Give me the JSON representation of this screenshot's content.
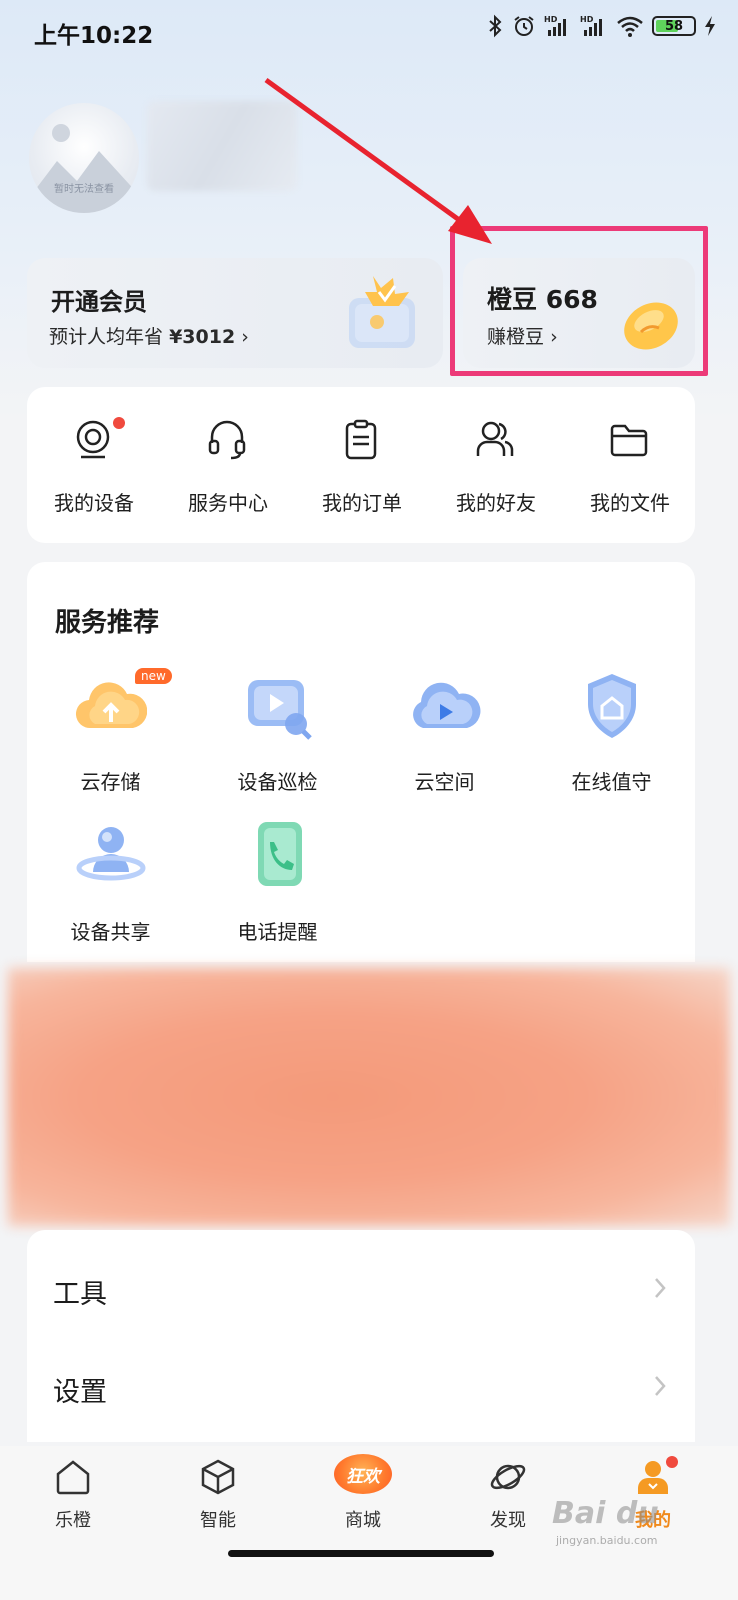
{
  "status_bar": {
    "time": "上午10:22",
    "battery": "58"
  },
  "profile": {
    "avatar_caption": "暂时无法查看"
  },
  "vip_card": {
    "title": "开通会员",
    "subtitle_prefix": "预计人均年省",
    "amount": "¥3012",
    "chevron": "›"
  },
  "beans_card": {
    "title": "橙豆 668",
    "subtitle": "赚橙豆",
    "chevron": "›"
  },
  "quick_menu": {
    "items": [
      {
        "label": "我的设备",
        "icon": "camera-icon",
        "has_dot": true
      },
      {
        "label": "服务中心",
        "icon": "headset-icon"
      },
      {
        "label": "我的订单",
        "icon": "clipboard-icon"
      },
      {
        "label": "我的好友",
        "icon": "friends-icon"
      },
      {
        "label": "我的文件",
        "icon": "folder-icon"
      }
    ]
  },
  "services": {
    "title": "服务推荐",
    "new_badge": "new",
    "items": [
      {
        "label": "云存储",
        "icon": "cloud-upload-icon"
      },
      {
        "label": "设备巡检",
        "icon": "device-inspect-icon"
      },
      {
        "label": "云空间",
        "icon": "cloud-space-icon"
      },
      {
        "label": "在线值守",
        "icon": "shield-home-icon"
      },
      {
        "label": "设备共享",
        "icon": "share-user-icon"
      },
      {
        "label": "电话提醒",
        "icon": "phone-alert-icon"
      }
    ]
  },
  "list": {
    "tools": "工具",
    "settings": "设置"
  },
  "tabbar": {
    "items": [
      {
        "label": "乐橙",
        "icon": "home-icon"
      },
      {
        "label": "智能",
        "icon": "cube-icon"
      },
      {
        "label": "商城",
        "icon": "mall-icon",
        "badge": "狂欢"
      },
      {
        "label": "发现",
        "icon": "planet-icon"
      },
      {
        "label": "我的",
        "icon": "user-icon",
        "active": true
      }
    ]
  },
  "watermark": {
    "text": "Bai du",
    "sub": "jingyan.baidu.com"
  },
  "colors": {
    "accent": "#f08a1c",
    "highlight": "#ec3a78",
    "arrow": "#e8232f"
  }
}
